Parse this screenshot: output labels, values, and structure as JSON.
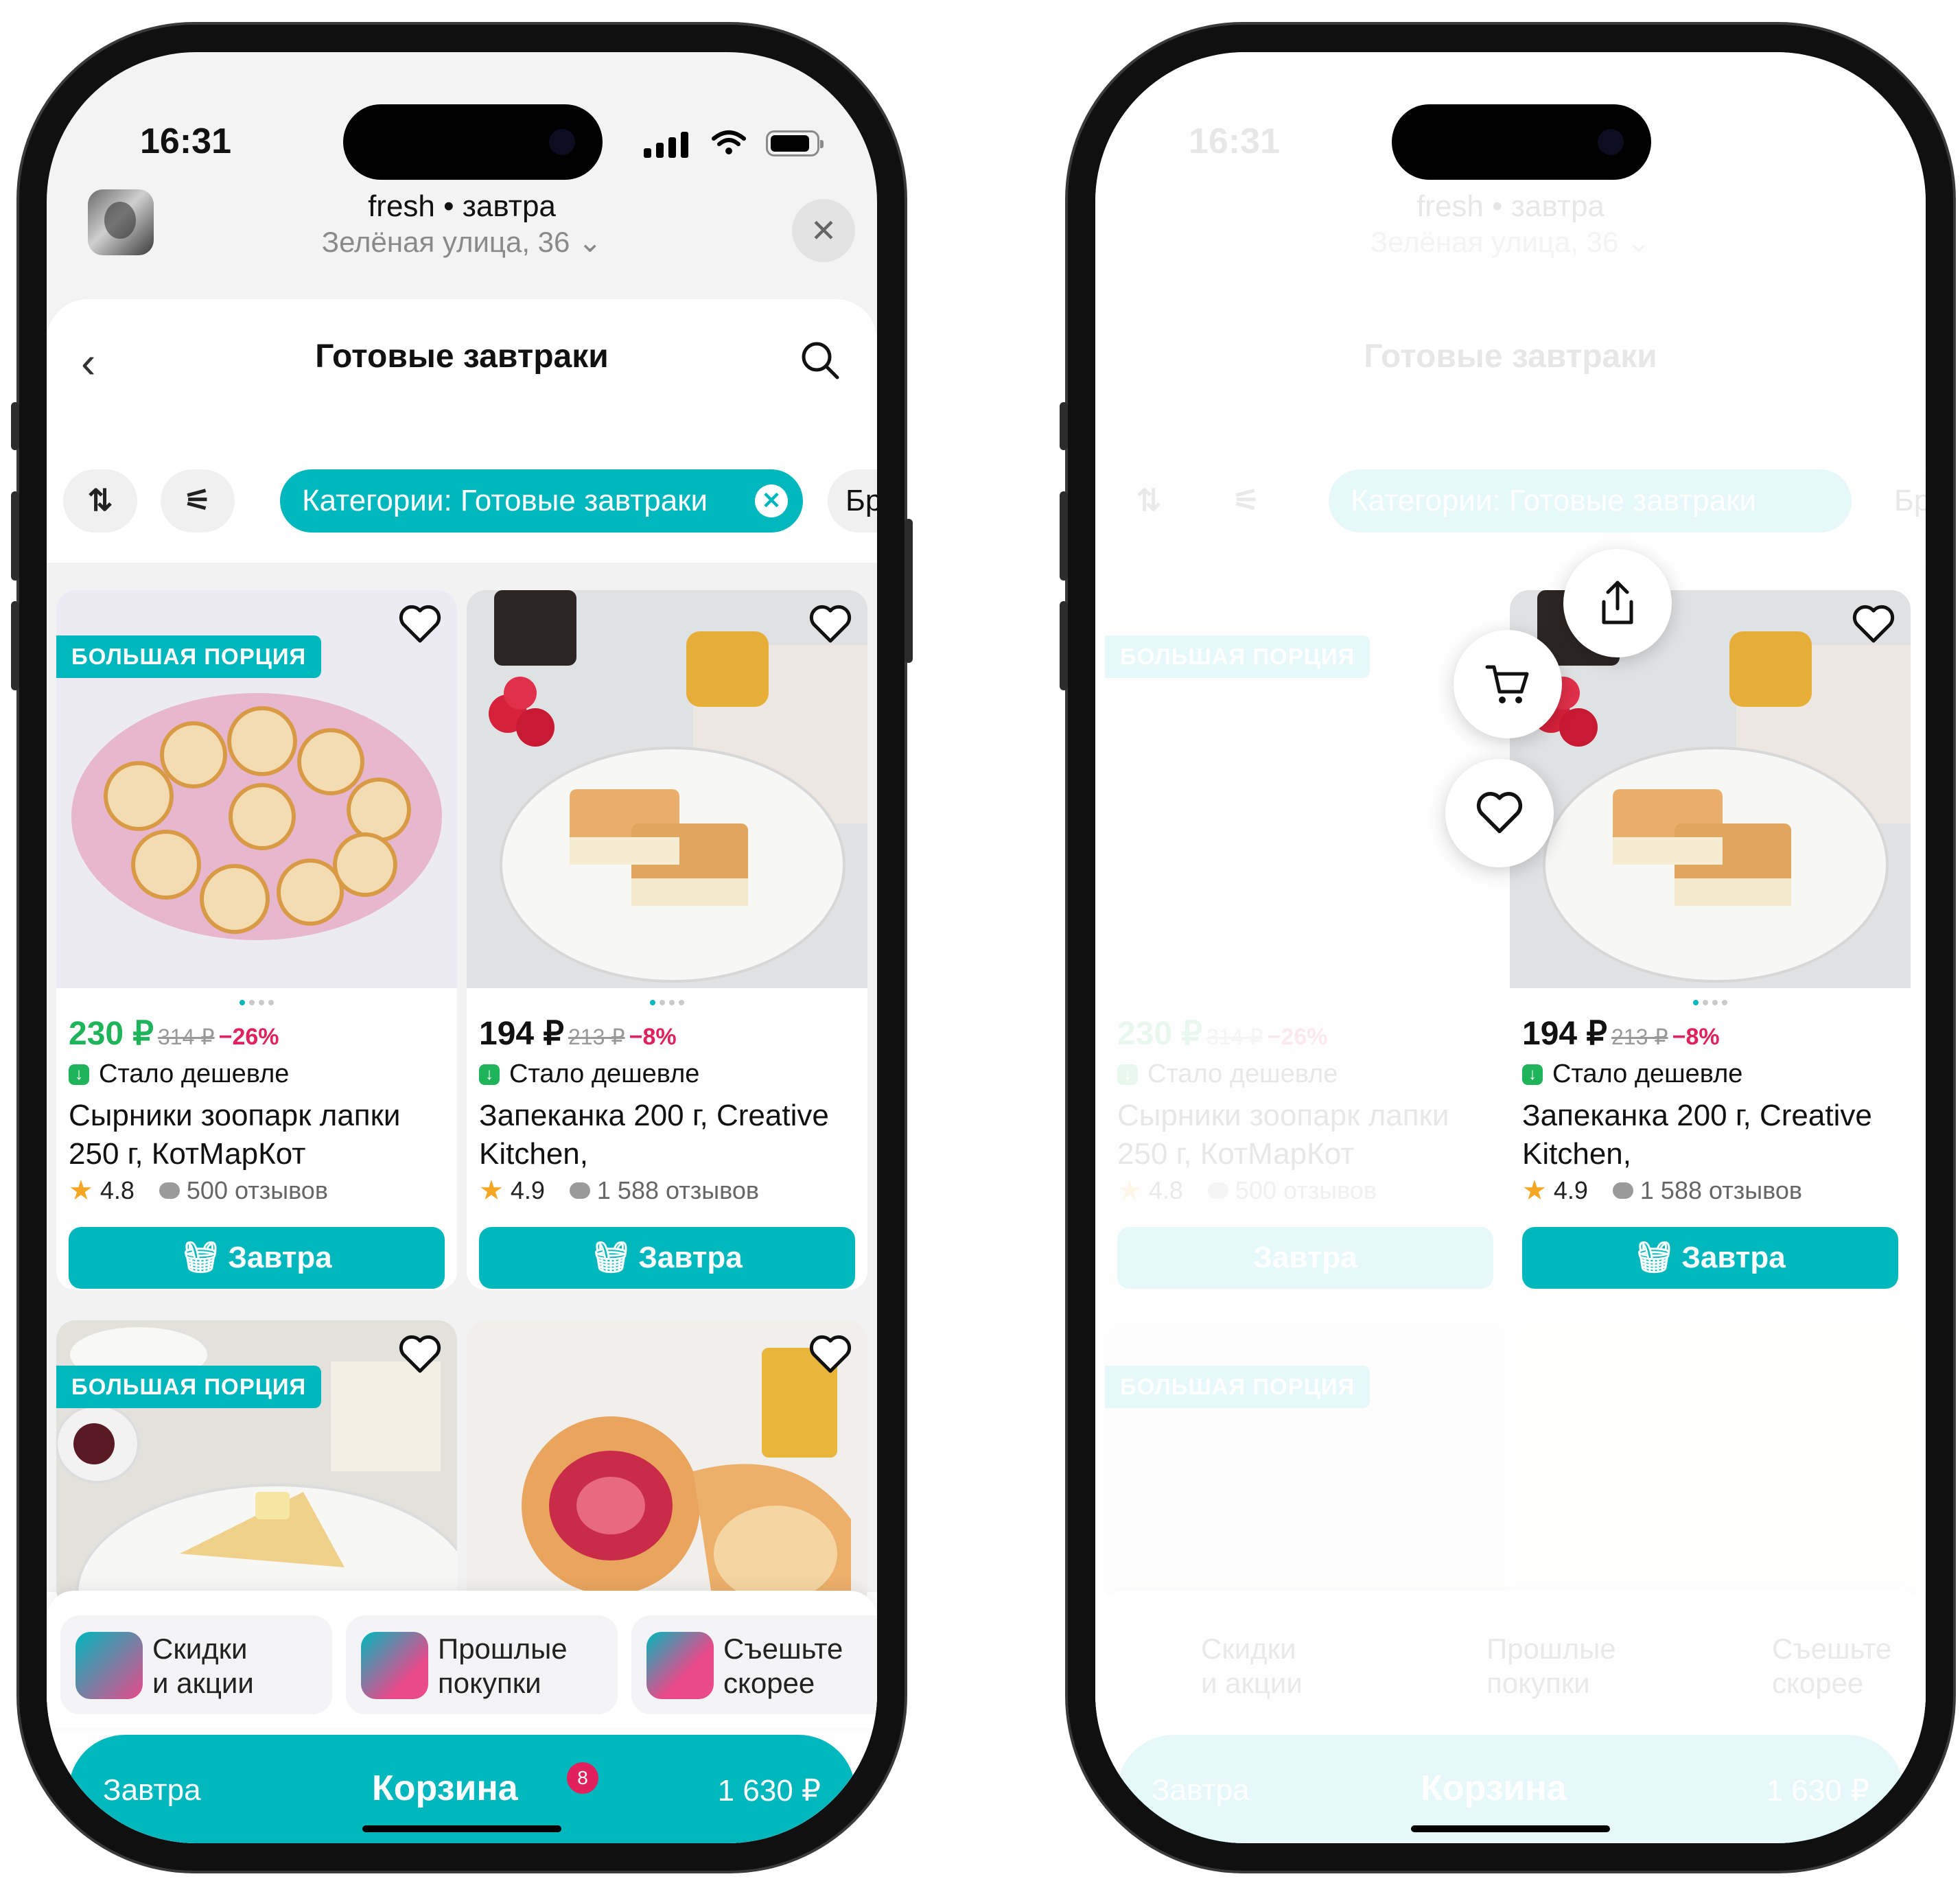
{
  "status": {
    "time": "16:31"
  },
  "header": {
    "store": "fresh • завтра",
    "address": "Зелёная улица, 36 ⌄"
  },
  "nav": {
    "title": "Готовые завтраки"
  },
  "filters": {
    "category_chip": "Категории: Готовые завтраки",
    "next_chip": "Бре"
  },
  "products": [
    {
      "badge": "БОЛЬШАЯ ПОРЦИЯ",
      "price": "230 ₽",
      "old_price": "314 ₽",
      "discount": "−26%",
      "price_color": "#1fb45a",
      "note": "Стало дешевле",
      "name": "Сырники зоопарк лапки 250 г, КотМарКот",
      "rating": "4.8",
      "reviews": "500 отзывов",
      "button": "Завтра"
    },
    {
      "badge": "",
      "price": "194 ₽",
      "old_price": "213 ₽",
      "discount": "−8%",
      "price_color": "#111111",
      "note": "Стало дешевле",
      "name": "Запеканка 200 г, Creative Kitchen,",
      "rating": "4.9",
      "reviews": "1 588 отзывов",
      "button": "Завтра"
    },
    {
      "badge": "БОЛЬШАЯ ПОРЦИЯ"
    },
    {
      "badge": ""
    }
  ],
  "promos": [
    {
      "line1": "Скидки",
      "line2": "и акции"
    },
    {
      "line1": "Прошлые",
      "line2": "покупки"
    },
    {
      "line1": "Съешьте",
      "line2": "скорее"
    }
  ],
  "cart": {
    "delivery": "Завтра",
    "label": "Корзина",
    "count": "8",
    "total": "1 630 ₽"
  },
  "context_menu": {
    "actions": [
      "share-icon",
      "cart-icon",
      "heart-icon"
    ]
  },
  "colors": {
    "accent": "#00b7bd",
    "sale": "#e0215d",
    "green": "#1fb45a"
  }
}
